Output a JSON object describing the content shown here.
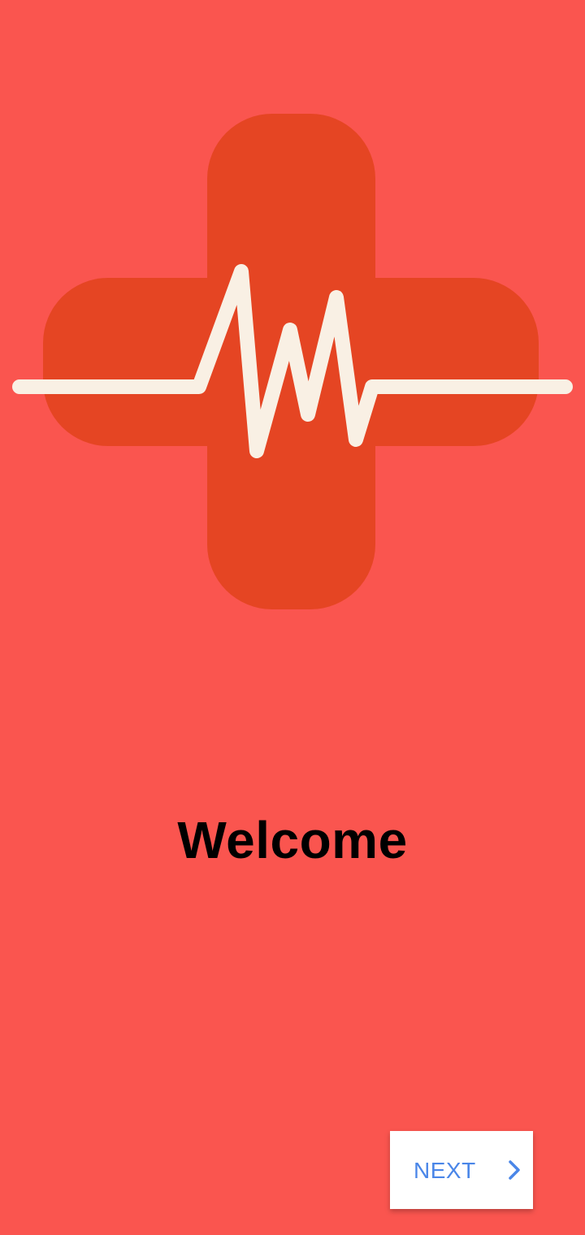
{
  "welcome": {
    "title": "Welcome"
  },
  "logo": {
    "icon": "heartbeat-medical-cross-icon"
  },
  "navigation": {
    "next_label": "NEXT",
    "next_icon": "chevron-right-icon"
  },
  "colors": {
    "background": "#FA554F",
    "cross": "#E54523",
    "pulse_line": "#F9F0E4",
    "button_background": "#FFFFFF",
    "button_text": "#4A86E8",
    "title_text": "#000000"
  }
}
